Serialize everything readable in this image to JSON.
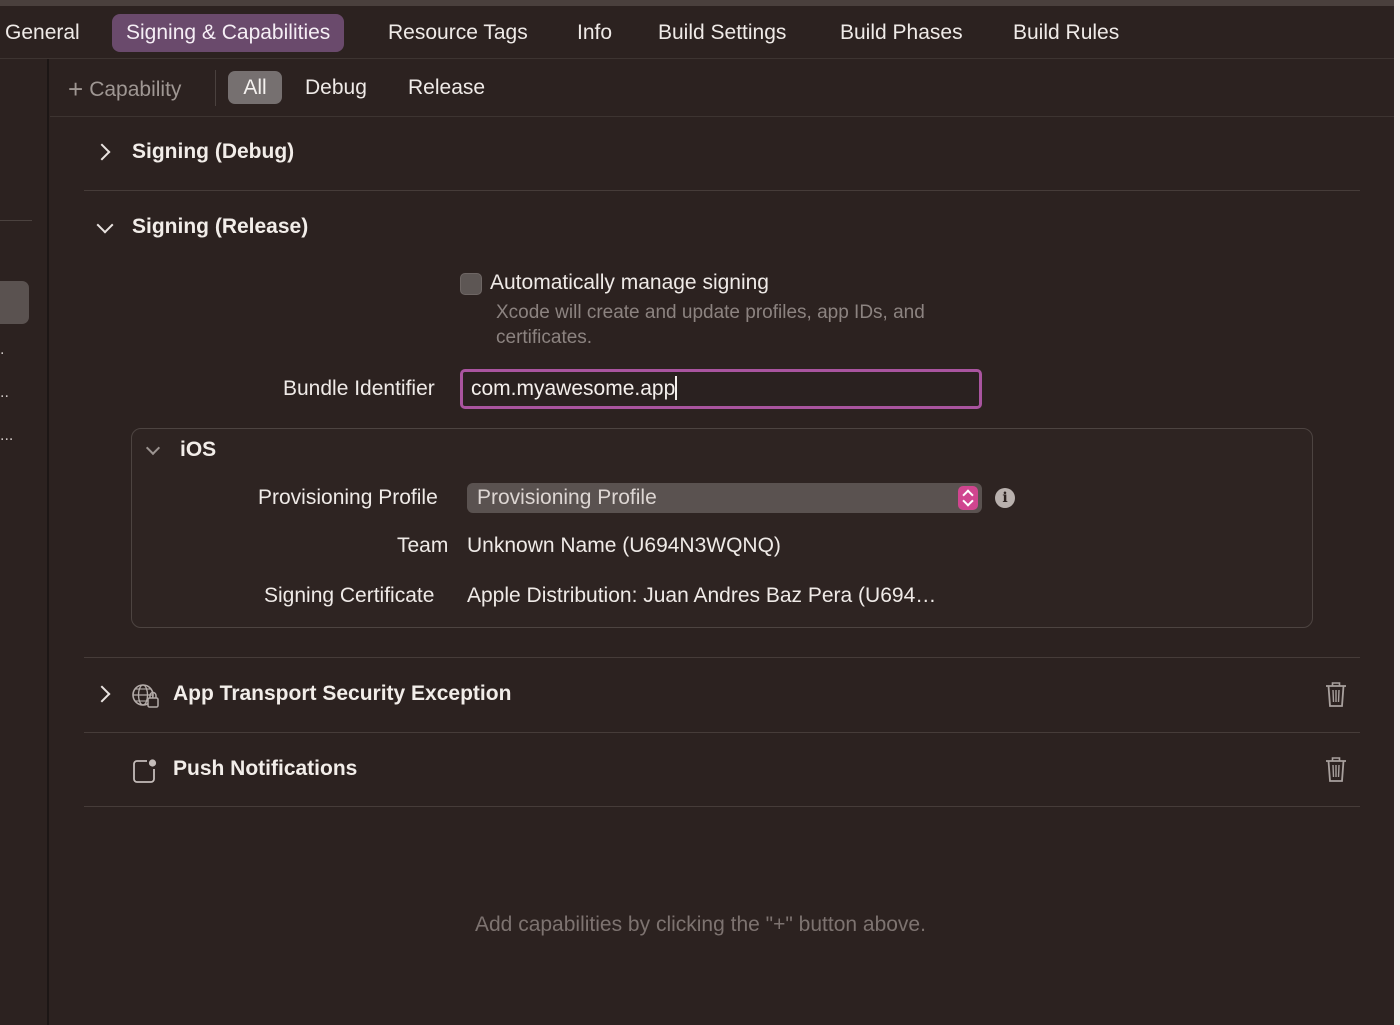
{
  "tabs": [
    {
      "label": "General"
    },
    {
      "label": "Signing & Capabilities"
    },
    {
      "label": "Resource Tags"
    },
    {
      "label": "Info"
    },
    {
      "label": "Build Settings"
    },
    {
      "label": "Build Phases"
    },
    {
      "label": "Build Rules"
    }
  ],
  "active_tab": "Signing & Capabilities",
  "scope_bar": {
    "capability_label": "Capability",
    "filters": [
      "All",
      "Debug",
      "Release"
    ],
    "selected_filter": "All"
  },
  "sections": {
    "signing_debug": {
      "title": "Signing (Debug)",
      "expanded": false
    },
    "signing_release": {
      "title": "Signing (Release)",
      "expanded": true,
      "auto_manage_label": "Automatically manage signing",
      "auto_manage_checked": false,
      "auto_manage_description": "Xcode will create and update profiles, app IDs, and certificates.",
      "bundle_identifier_label": "Bundle Identifier",
      "bundle_identifier_value": "com.myawesome.app",
      "platform": {
        "name": "iOS",
        "provisioning_profile_label": "Provisioning Profile",
        "provisioning_profile_value": "Provisioning Profile",
        "team_label": "Team",
        "team_value": "Unknown Name (U694N3WQNQ)",
        "signing_certificate_label": "Signing Certificate",
        "signing_certificate_value": "Apple Distribution: Juan Andres Baz Pera (U694…"
      }
    },
    "app_transport_security": {
      "title": "App Transport Security Exception",
      "icon": "globe-lock-icon"
    },
    "push_notifications": {
      "title": "Push Notifications",
      "icon": "notification-badge-icon"
    }
  },
  "empty_hint": "Add capabilities by clicking the \"+\" button above.",
  "colors": {
    "background": "#2c2220",
    "accent": "#6a4a6c",
    "focus_ring": "#a9549f",
    "popup_arrow": "#d0458f"
  }
}
